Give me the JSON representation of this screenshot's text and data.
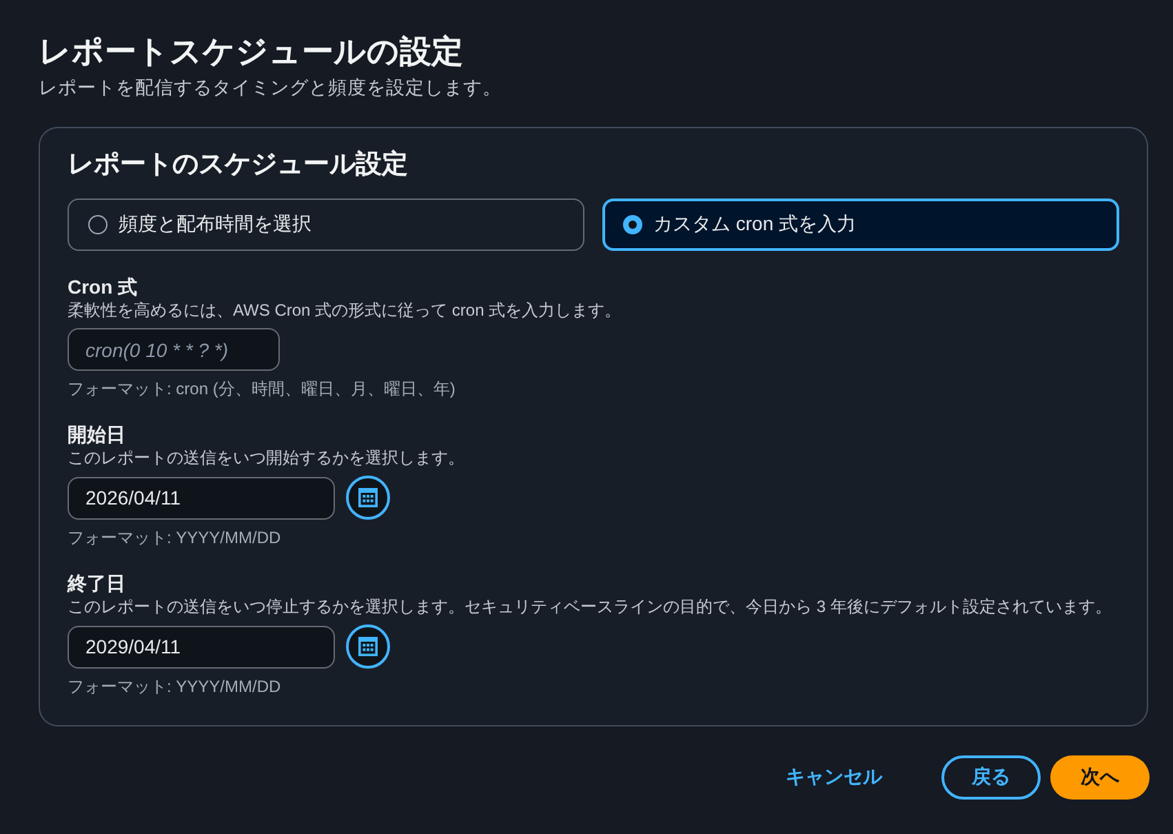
{
  "page": {
    "title": "レポートスケジュールの設定",
    "description": "レポートを配信するタイミングと頻度を設定します。"
  },
  "card": {
    "title": "レポートのスケジュール設定",
    "options": [
      {
        "label": "頻度と配布時間を選択",
        "selected": false
      },
      {
        "label": "カスタム cron 式を入力",
        "selected": true
      }
    ],
    "fields": [
      {
        "kind": "text",
        "label": "Cron 式",
        "description": "柔軟性を高めるには、AWS Cron 式の形式に従って cron 式を入力します。",
        "placeholder": "cron(0 10 * * ? *)",
        "hint": "フォーマット: cron (分、時間、曜日、月、曜日、年)"
      },
      {
        "kind": "date",
        "label": "開始日",
        "description": "このレポートの送信をいつ開始するかを選択します。",
        "value": "2026/04/11",
        "hint": "フォーマット: YYYY/MM/DD"
      },
      {
        "kind": "date",
        "label": "終了日",
        "description": "このレポートの送信をいつ停止するかを選択します。セキュリティベースラインの目的で、今日から 3 年後にデフォルト設定されています。",
        "value": "2029/04/11",
        "hint": "フォーマット: YYYY/MM/DD"
      }
    ]
  },
  "actions": [
    {
      "kind": "link",
      "label": "キャンセル"
    },
    {
      "kind": "secondary",
      "label": "戻る"
    },
    {
      "kind": "primary",
      "label": "次へ"
    }
  ]
}
